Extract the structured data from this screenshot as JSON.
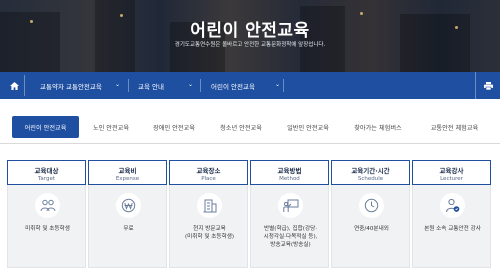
{
  "hero": {
    "title": "어린이 안전교육",
    "subtitle": "경기도교통연수원은 올바르고 안전한 교통문화정착에 앞장섭니다."
  },
  "navbar": {
    "home_icon": "home-icon",
    "items": [
      {
        "label": "교통약자 교통안전교육"
      },
      {
        "label": "교육 안내"
      },
      {
        "label": "어린이 안전교육"
      }
    ],
    "print_icon": "printer-icon",
    "color": "#1f4fa0"
  },
  "tabs": [
    {
      "label": "어린이 안전교육",
      "active": true
    },
    {
      "label": "노인 안전교육",
      "active": false
    },
    {
      "label": "장애인 안전교육",
      "active": false
    },
    {
      "label": "청소년 안전교육",
      "active": false
    },
    {
      "label": "일반인 안전교육",
      "active": false
    },
    {
      "label": "찾아가는 체험버스",
      "active": false
    },
    {
      "label": "교통안전 체험교육",
      "active": false
    }
  ],
  "info": [
    {
      "title": "교육대상",
      "subtitle": "Target",
      "icon": "people-icon",
      "lines": [
        "미취학 및 초등학생"
      ]
    },
    {
      "title": "교육비",
      "subtitle": "Expense",
      "icon": "won-coin-icon",
      "lines": [
        "무료"
      ]
    },
    {
      "title": "교육장소",
      "subtitle": "Place",
      "icon": "building-icon",
      "lines": [
        "현지 방문교육",
        "(미취학 및 초등학생)"
      ]
    },
    {
      "title": "교육방법",
      "subtitle": "Method",
      "icon": "presentation-icon",
      "lines": [
        "반별(학급), 집합(강당·",
        "시청각실·다목적실 등),",
        "방송교육(방송실)"
      ]
    },
    {
      "title": "교육기간·시간",
      "subtitle": "Schedule",
      "icon": "clock-icon",
      "lines": [
        "연중/40분내외"
      ]
    },
    {
      "title": "교육강사",
      "subtitle": "Lecturer",
      "icon": "lecturer-icon",
      "lines": [
        "본원 소속 교통안전 강사"
      ]
    }
  ]
}
